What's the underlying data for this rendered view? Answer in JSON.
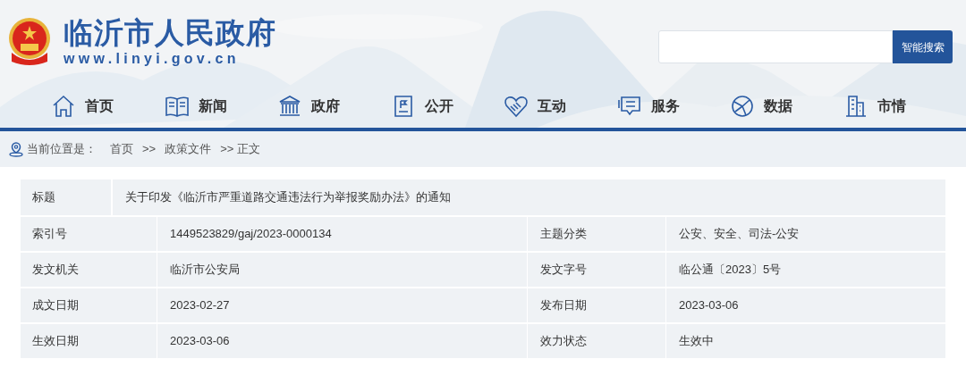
{
  "site": {
    "title": "临沂市人民政府",
    "url": "www.linyi.gov.cn"
  },
  "search": {
    "button": "智能搜索"
  },
  "nav": [
    {
      "label": "首页",
      "kind": "home"
    },
    {
      "label": "新闻",
      "kind": "news"
    },
    {
      "label": "政府",
      "kind": "gov"
    },
    {
      "label": "公开",
      "kind": "open"
    },
    {
      "label": "互动",
      "kind": "interact"
    },
    {
      "label": "服务",
      "kind": "service"
    },
    {
      "label": "数据",
      "kind": "data"
    },
    {
      "label": "市情",
      "kind": "city"
    }
  ],
  "breadcrumb": {
    "prefix": "当前位置是：",
    "items": [
      "首页",
      ">>",
      "政策文件",
      ">> 正文"
    ]
  },
  "document": {
    "title_label": "标题",
    "title": "关于印发《临沂市严重道路交通违法行为举报奖励办法》的通知",
    "rows": [
      [
        "索引号",
        "1449523829/gaj/2023-0000134",
        "主题分类",
        "公安、安全、司法-公安"
      ],
      [
        "发文机关",
        "临沂市公安局",
        "发文字号",
        "临公通〔2023〕5号"
      ],
      [
        "成文日期",
        "2023-02-27",
        "发布日期",
        "2023-03-06"
      ],
      [
        "生效日期",
        "2023-03-06",
        "效力状态",
        "生效中"
      ]
    ]
  }
}
